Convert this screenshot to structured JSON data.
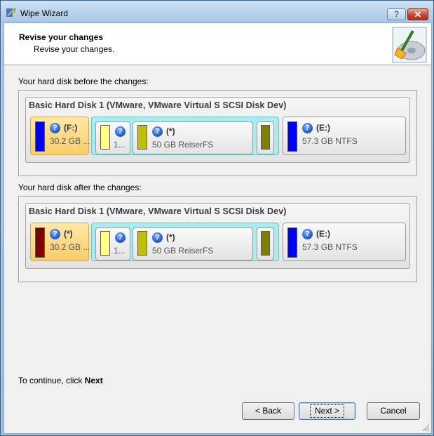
{
  "window": {
    "title": "Wipe Wizard",
    "help_label": "?",
    "close_label": "✕"
  },
  "header": {
    "title": "Revise your changes",
    "subtitle": "Revise your changes."
  },
  "before": {
    "label": "Your hard disk before the changes:",
    "disk_title": "Basic Hard Disk 1 (VMware, VMware Virtual S SCSI Disk Dev)",
    "p1": {
      "name": "(F:)",
      "size": "30.2 GB ..."
    },
    "p2": {
      "size": "1..."
    },
    "p3": {
      "name": "(*)",
      "size": "50 GB ReiserFS"
    },
    "p5": {
      "name": "(E:)",
      "size": "57.3 GB NTFS"
    }
  },
  "after": {
    "label": "Your hard disk after the changes:",
    "disk_title": "Basic Hard Disk 1 (VMware, VMware Virtual S SCSI Disk Dev)",
    "p1": {
      "name": "(*)",
      "size": "30.2 GB ..."
    },
    "p2": {
      "size": "1..."
    },
    "p3": {
      "name": "(*)",
      "size": "50 GB ReiserFS"
    },
    "p5": {
      "name": "(E:)",
      "size": "57.3 GB NTFS"
    }
  },
  "footer": {
    "prefix": "To continue, click ",
    "next_word": "Next"
  },
  "buttons": {
    "back": "< Back",
    "next": "Next >",
    "cancel": "Cancel"
  },
  "colors": {
    "ntfs_bar": "#0000ff",
    "fat_bar": "#ffff88",
    "reiser_bar": "#c0c000",
    "swap_bar": "#808000",
    "wiped_bar": "#800000",
    "extended_bg": "#a8eef0"
  },
  "icons": [
    "wipe-wizard-app-icon",
    "help-icon",
    "close-icon",
    "disk-broom-icon",
    "question-icon",
    "resize-grip-icon"
  ]
}
